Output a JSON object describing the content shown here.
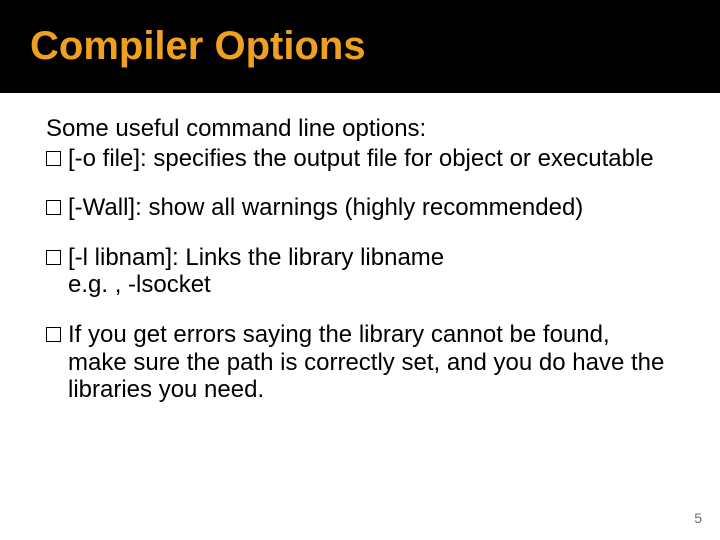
{
  "title": "Compiler Options",
  "intro": "Some useful command line options:",
  "bullets": [
    {
      "text": "[-o file]: specifies the output file for object or executable"
    },
    {
      "text": "[-Wall]: show all warnings (highly recommended)"
    },
    {
      "text": "[-l libnam]: Links the library libname",
      "sub": "e.g. , -lsocket"
    },
    {
      "text": "If you get errors saying the library cannot be found, make sure the path is correctly set, and you do have the libraries you need."
    }
  ],
  "page_number": "5"
}
